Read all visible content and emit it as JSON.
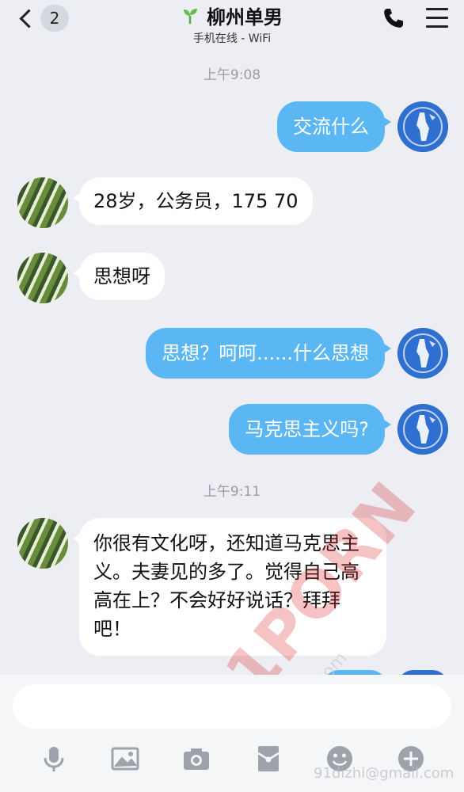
{
  "header": {
    "unread_count": "2",
    "title": "柳州单男",
    "subtitle": "手机在线 - WiFi"
  },
  "timestamps": [
    "上午9:08",
    "上午9:11"
  ],
  "messages": [
    {
      "side": "out",
      "text": "交流什么"
    },
    {
      "side": "in",
      "text": "28岁，公务员，175 70"
    },
    {
      "side": "in",
      "text": "思想呀"
    },
    {
      "side": "out",
      "text": "思想？呵呵......什么思想"
    },
    {
      "side": "out",
      "text": "马克思主义吗?"
    },
    {
      "side": "in",
      "text": "你很有文化呀，还知道马克思主义。夫妻见的多了。觉得自己高高在上？不会好好说话？拜拜吧！"
    }
  ],
  "watermark": {
    "main": "91PORN",
    "email1": "91dizhi@gmail.com",
    "email2": "91dizhi@gmail.com"
  },
  "toolbar": [
    "mic-icon",
    "image-icon",
    "camera-icon",
    "red-packet-icon",
    "emoji-icon",
    "plus-icon"
  ],
  "colors": {
    "outgoing_bubble": "#5bb7f3",
    "incoming_bubble": "#ffffff",
    "background": "#eceef4"
  }
}
